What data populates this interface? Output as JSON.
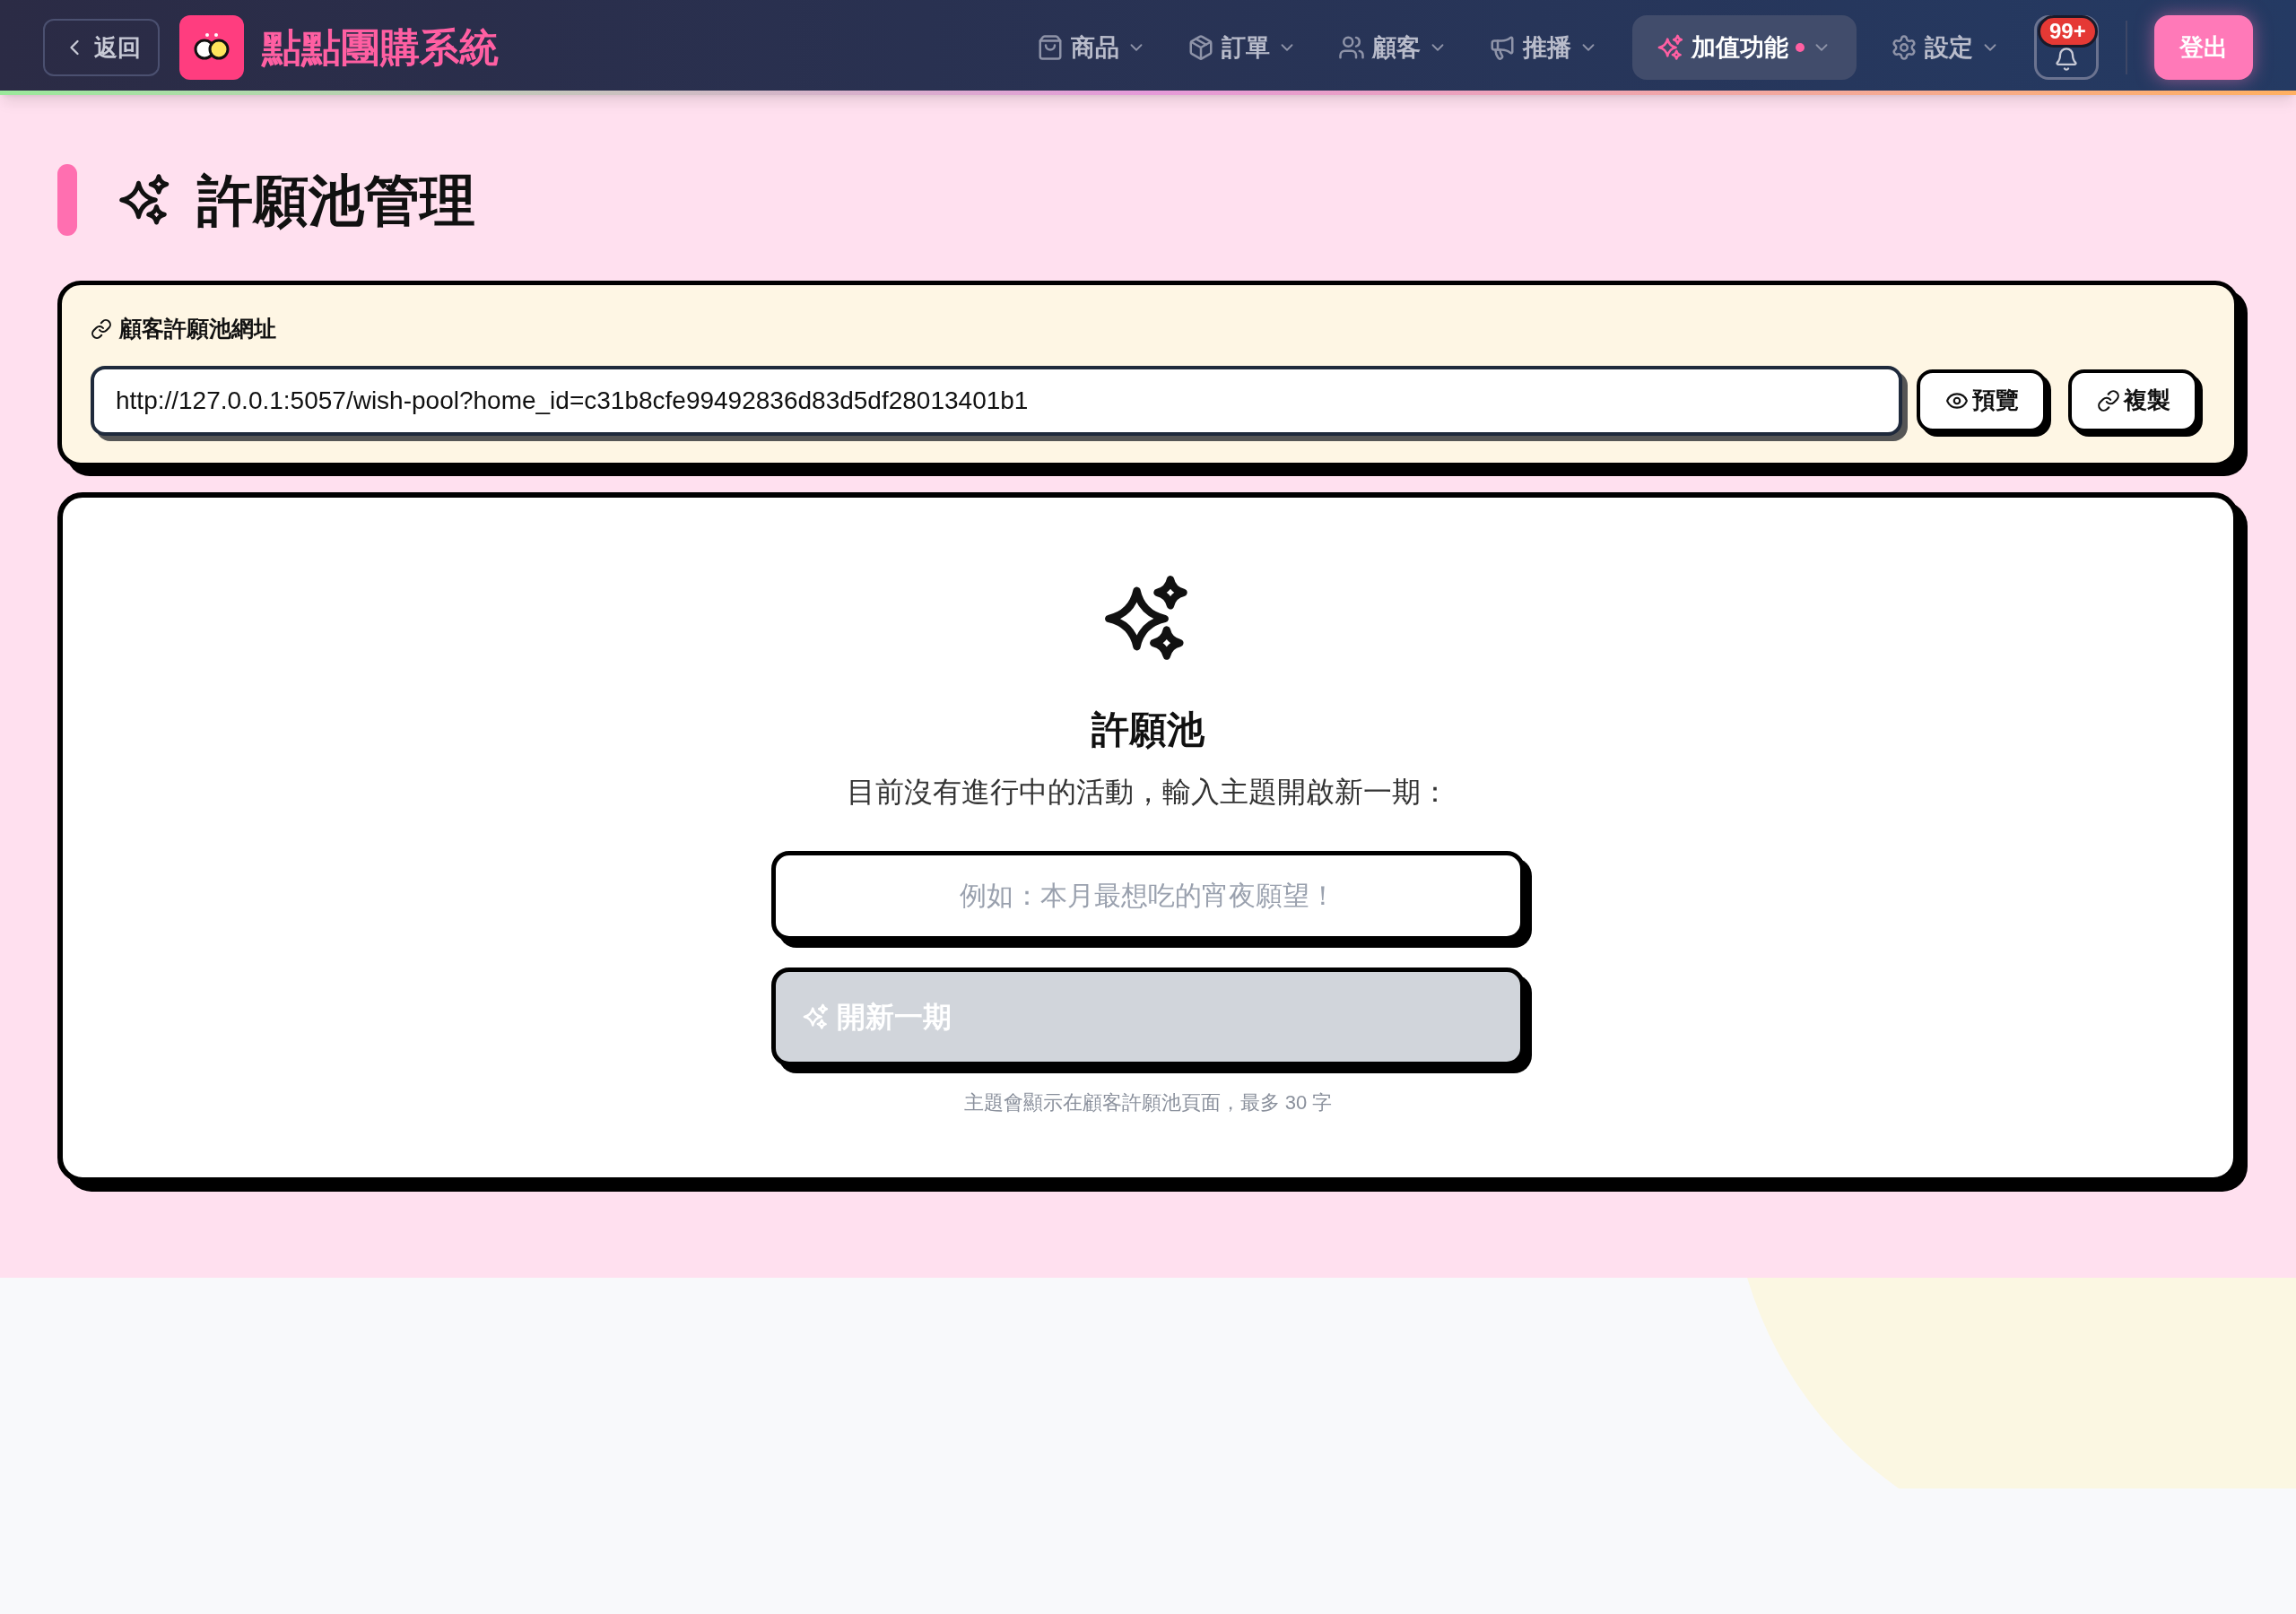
{
  "topbar": {
    "back_label": "返回",
    "app_name": "點點團購系統",
    "nav": [
      {
        "kind": "bag",
        "label": "商品",
        "selected": false,
        "dot": false
      },
      {
        "kind": "box",
        "label": "訂單",
        "selected": false,
        "dot": false
      },
      {
        "kind": "users",
        "label": "顧客",
        "selected": false,
        "dot": false
      },
      {
        "kind": "megaphone",
        "label": "推播",
        "selected": false,
        "dot": false
      },
      {
        "kind": "sparkles",
        "label": "加值功能",
        "selected": true,
        "dot": true
      },
      {
        "kind": "gear",
        "label": "設定",
        "selected": false,
        "dot": false
      }
    ],
    "notification_badge": "99+",
    "logout_label": "登出"
  },
  "page_title": "許願池管理",
  "url_card": {
    "label": "顧客許願池網址",
    "url": "http://127.0.0.1:5057/wish-pool?home_id=c31b8cfe99492836d83d5df28013401b1",
    "buttons": [
      {
        "kind": "preview",
        "label": "預覽"
      },
      {
        "kind": "copy",
        "label": "複製"
      }
    ]
  },
  "empty_state": {
    "title": "許願池",
    "message": "目前沒有進行中的活動，輸入主題開啟新一期：",
    "topic_input": {
      "placeholder": "例如：本月最想吃的宵夜願望！"
    },
    "start_button": {
      "label": "開新一期",
      "disabled": true
    },
    "hint": "主題會顯示在顧客許願池頁面，最多 30 字"
  }
}
